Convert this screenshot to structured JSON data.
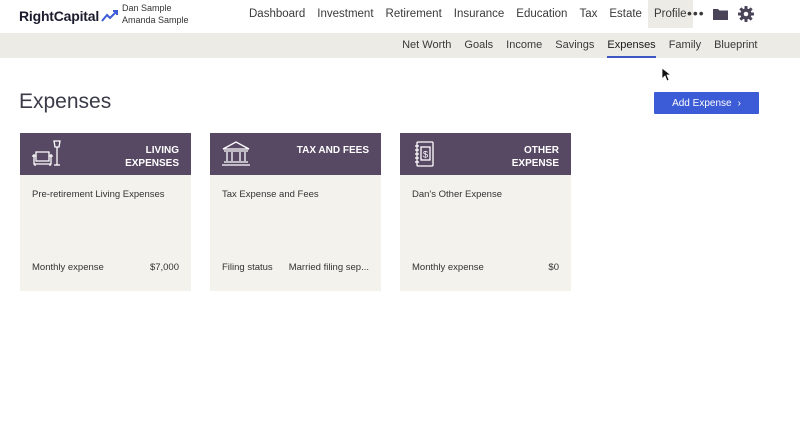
{
  "brand": {
    "name": "RightCapital",
    "accent": "#3c5bd6",
    "card_header": "#574863"
  },
  "users": [
    "Dan Sample",
    "Amanda Sample"
  ],
  "main_nav": [
    {
      "label": "Dashboard",
      "active": false
    },
    {
      "label": "Investment",
      "active": false
    },
    {
      "label": "Retirement",
      "active": false
    },
    {
      "label": "Insurance",
      "active": false
    },
    {
      "label": "Education",
      "active": false
    },
    {
      "label": "Tax",
      "active": false
    },
    {
      "label": "Estate",
      "active": false
    },
    {
      "label": "Profile",
      "active": true
    }
  ],
  "toolbar_icons": [
    "more-icon",
    "folder-icon",
    "gear-icon"
  ],
  "sub_nav": [
    {
      "label": "Net Worth",
      "active": false
    },
    {
      "label": "Goals",
      "active": false
    },
    {
      "label": "Income",
      "active": false
    },
    {
      "label": "Savings",
      "active": false
    },
    {
      "label": "Expenses",
      "active": true
    },
    {
      "label": "Family",
      "active": false
    },
    {
      "label": "Blueprint",
      "active": false
    }
  ],
  "page": {
    "title": "Expenses",
    "add_button": "Add Expense"
  },
  "cards": [
    {
      "icon": "sofa-lamp-icon",
      "title_lines": [
        "LIVING",
        "EXPENSES"
      ],
      "subtitle": "Pre-retirement Living Expenses",
      "label": "Monthly expense",
      "value": "$7,000"
    },
    {
      "icon": "bank-icon",
      "title_lines": [
        "TAX AND FEES"
      ],
      "subtitle": "Tax Expense and Fees",
      "label": "Filing status",
      "value": "Married filing sep..."
    },
    {
      "icon": "dollar-document-icon",
      "title_lines": [
        "OTHER",
        "EXPENSE"
      ],
      "subtitle": "Dan's Other Expense",
      "label": "Monthly expense",
      "value": "$0"
    }
  ]
}
